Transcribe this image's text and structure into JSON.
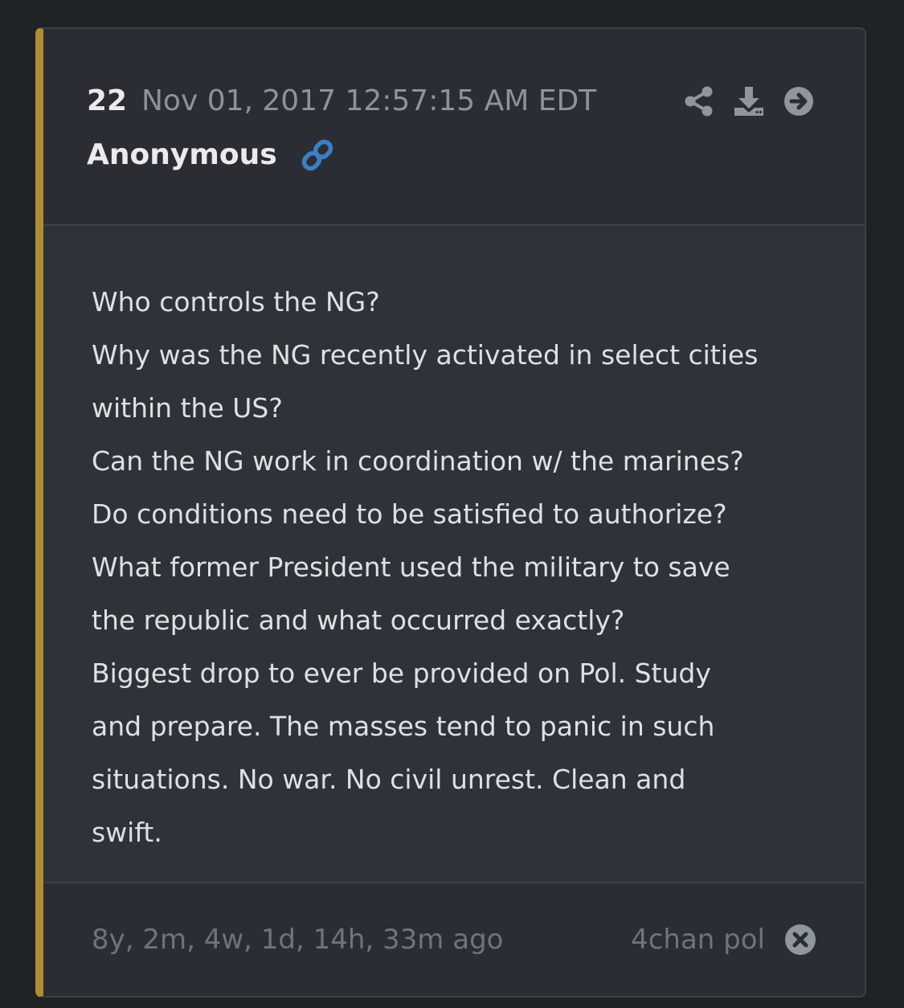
{
  "post": {
    "number": "22",
    "timestamp": "Nov 01, 2017 12:57:15 AM EDT",
    "author": "Anonymous",
    "icons": {
      "share": "share-icon",
      "download": "download-icon",
      "navigate": "arrow-circle-right-icon",
      "link": "link-icon",
      "close": "close-circle-icon"
    },
    "lines": [
      "Who controls the NG?",
      "Why was the NG recently activated in select cities",
      "within the US?",
      "Can the NG work in coordination w/ the marines?",
      "Do conditions need to be satisfied to authorize?",
      "What former President used the military to save",
      "the republic and what occurred exactly?",
      "Biggest drop to ever be provided on Pol. Study",
      "and prepare. The masses tend to panic in such",
      "situations. No war. No civil unrest. Clean and",
      "swift."
    ],
    "age": "8y, 2m, 4w, 1d, 14h, 33m ago",
    "source": "4chan pol"
  },
  "colors": {
    "accent_bar": "#b08c35",
    "link_blue": "#3b7fc4",
    "background": "#1f2226"
  }
}
